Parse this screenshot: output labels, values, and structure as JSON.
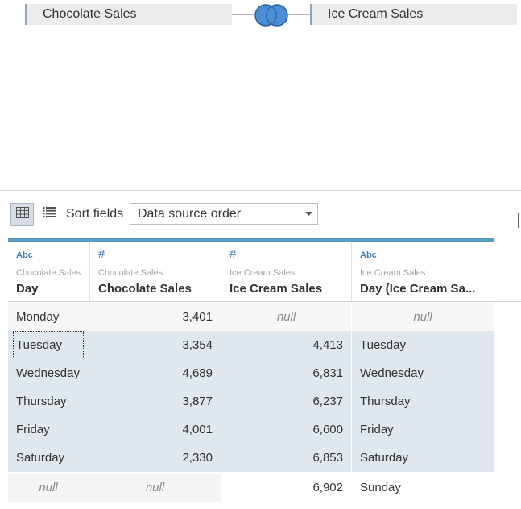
{
  "join": {
    "left_table": "Chocolate Sales",
    "right_table": "Ice Cream Sales",
    "icon": "full-outer-join-icon",
    "colors": {
      "join_circle": "#4a8fd4",
      "join_outline": "#2a5f99"
    }
  },
  "toolbar": {
    "grid_view_icon": "grid-view-icon",
    "list_view_icon": "list-view-icon",
    "sort_label": "Sort fields",
    "sort_value": "Data source order"
  },
  "columns": [
    {
      "type": "Abc",
      "source": "Chocolate Sales",
      "name": "Day"
    },
    {
      "type": "#",
      "source": "Chocolate Sales",
      "name": "Chocolate Sales"
    },
    {
      "type": "#",
      "source": "Ice Cream Sales",
      "name": "Ice Cream Sales"
    },
    {
      "type": "Abc",
      "source": "Ice Cream Sales",
      "name": "Day (Ice Cream Sa..."
    }
  ],
  "rows": [
    [
      "Monday",
      "3,401",
      "null",
      "null"
    ],
    [
      "Tuesday",
      "3,354",
      "4,413",
      "Tuesday"
    ],
    [
      "Wednesday",
      "4,689",
      "6,831",
      "Wednesday"
    ],
    [
      "Thursday",
      "3,877",
      "6,237",
      "Thursday"
    ],
    [
      "Friday",
      "4,001",
      "6,600",
      "Friday"
    ],
    [
      "Saturday",
      "2,330",
      "6,853",
      "Saturday"
    ],
    [
      "null",
      "null",
      "6,902",
      "Sunday"
    ]
  ],
  "colors": {
    "accent": "#5a9bc4",
    "selection": "#e1e7ee",
    "type_icon": "#3e7eb0"
  }
}
